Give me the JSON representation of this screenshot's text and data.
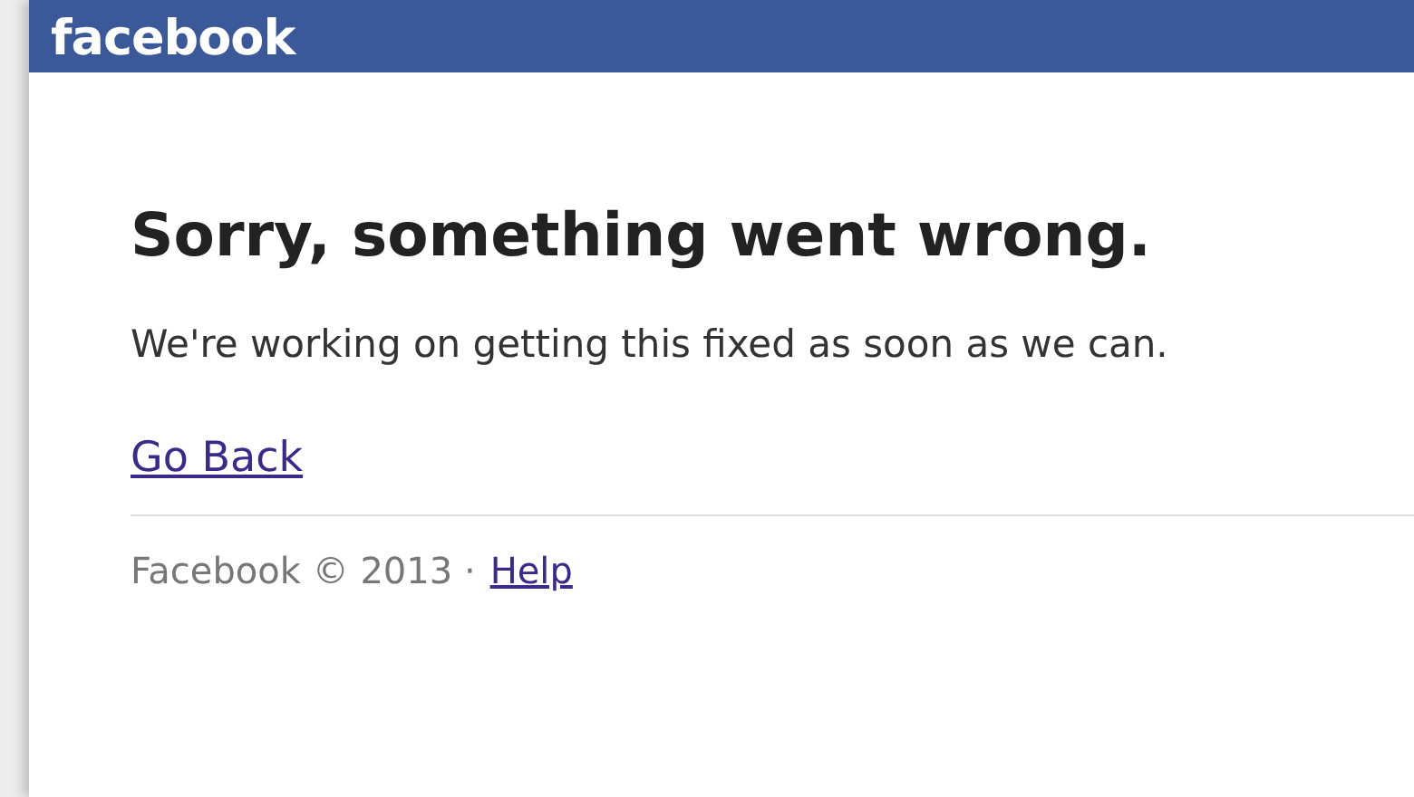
{
  "header": {
    "logo": "facebook"
  },
  "error": {
    "title": "Sorry, something went wrong.",
    "message": "We're working on getting this fixed as soon as we can.",
    "link": "Go Back"
  },
  "footer": {
    "copyright": "Facebook © 2013 ·",
    "link": "Help"
  }
}
